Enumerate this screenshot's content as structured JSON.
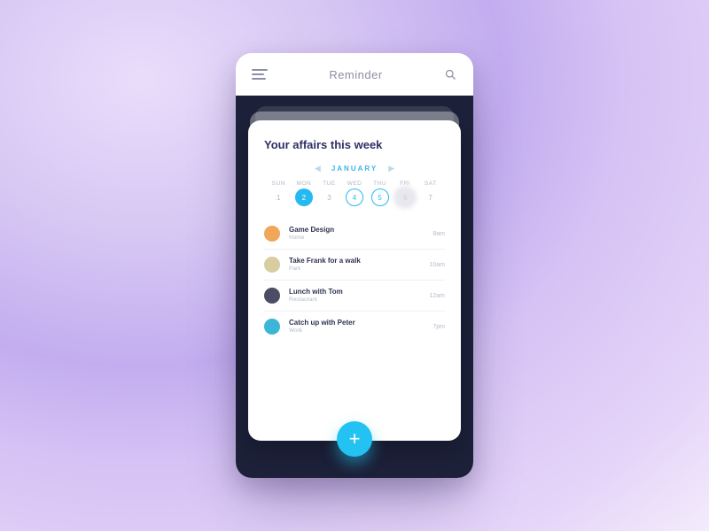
{
  "header": {
    "title": "Reminder"
  },
  "card": {
    "title": "Your affairs this week",
    "month": "JANUARY",
    "weekdays": [
      "SUN",
      "MON",
      "TUE",
      "WED",
      "THU",
      "FRI",
      "SAT"
    ],
    "days": [
      {
        "n": "1",
        "state": "plain"
      },
      {
        "n": "2",
        "state": "selected"
      },
      {
        "n": "3",
        "state": "plain"
      },
      {
        "n": "4",
        "state": "ring"
      },
      {
        "n": "5",
        "state": "ring"
      },
      {
        "n": "6",
        "state": "blur"
      },
      {
        "n": "7",
        "state": "plain"
      }
    ],
    "events": [
      {
        "title": "Game Design",
        "sub": "Home",
        "time": "8am",
        "avatar_bg": "#f2a65a"
      },
      {
        "title": "Take Frank for a walk",
        "sub": "Park",
        "time": "10am",
        "avatar_bg": "#d8cda0"
      },
      {
        "title": "Lunch with Tom",
        "sub": "Restaurant",
        "time": "12am",
        "avatar_bg": "#4a4d63"
      },
      {
        "title": "Catch up with Peter",
        "sub": "Work",
        "time": "7pm",
        "avatar_bg": "#3bb6d6"
      }
    ]
  },
  "fab": {
    "glyph": "+"
  }
}
